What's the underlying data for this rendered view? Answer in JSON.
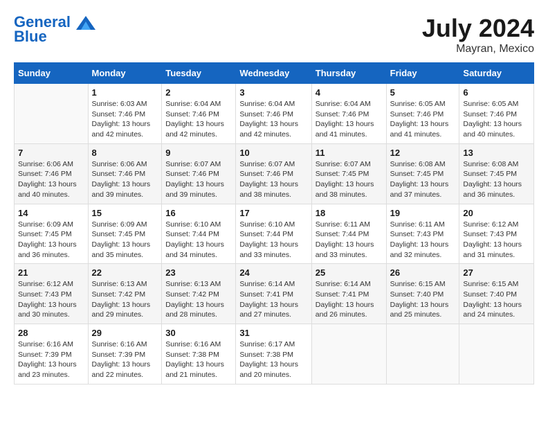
{
  "header": {
    "logo_line1": "General",
    "logo_line2": "Blue",
    "month": "July 2024",
    "location": "Mayran, Mexico"
  },
  "days_of_week": [
    "Sunday",
    "Monday",
    "Tuesday",
    "Wednesday",
    "Thursday",
    "Friday",
    "Saturday"
  ],
  "weeks": [
    [
      {
        "day": "",
        "sunrise": "",
        "sunset": "",
        "daylight": ""
      },
      {
        "day": "1",
        "sunrise": "Sunrise: 6:03 AM",
        "sunset": "Sunset: 7:46 PM",
        "daylight": "Daylight: 13 hours and 42 minutes."
      },
      {
        "day": "2",
        "sunrise": "Sunrise: 6:04 AM",
        "sunset": "Sunset: 7:46 PM",
        "daylight": "Daylight: 13 hours and 42 minutes."
      },
      {
        "day": "3",
        "sunrise": "Sunrise: 6:04 AM",
        "sunset": "Sunset: 7:46 PM",
        "daylight": "Daylight: 13 hours and 42 minutes."
      },
      {
        "day": "4",
        "sunrise": "Sunrise: 6:04 AM",
        "sunset": "Sunset: 7:46 PM",
        "daylight": "Daylight: 13 hours and 41 minutes."
      },
      {
        "day": "5",
        "sunrise": "Sunrise: 6:05 AM",
        "sunset": "Sunset: 7:46 PM",
        "daylight": "Daylight: 13 hours and 41 minutes."
      },
      {
        "day": "6",
        "sunrise": "Sunrise: 6:05 AM",
        "sunset": "Sunset: 7:46 PM",
        "daylight": "Daylight: 13 hours and 40 minutes."
      }
    ],
    [
      {
        "day": "7",
        "sunrise": "Sunrise: 6:06 AM",
        "sunset": "Sunset: 7:46 PM",
        "daylight": "Daylight: 13 hours and 40 minutes."
      },
      {
        "day": "8",
        "sunrise": "Sunrise: 6:06 AM",
        "sunset": "Sunset: 7:46 PM",
        "daylight": "Daylight: 13 hours and 39 minutes."
      },
      {
        "day": "9",
        "sunrise": "Sunrise: 6:07 AM",
        "sunset": "Sunset: 7:46 PM",
        "daylight": "Daylight: 13 hours and 39 minutes."
      },
      {
        "day": "10",
        "sunrise": "Sunrise: 6:07 AM",
        "sunset": "Sunset: 7:46 PM",
        "daylight": "Daylight: 13 hours and 38 minutes."
      },
      {
        "day": "11",
        "sunrise": "Sunrise: 6:07 AM",
        "sunset": "Sunset: 7:45 PM",
        "daylight": "Daylight: 13 hours and 38 minutes."
      },
      {
        "day": "12",
        "sunrise": "Sunrise: 6:08 AM",
        "sunset": "Sunset: 7:45 PM",
        "daylight": "Daylight: 13 hours and 37 minutes."
      },
      {
        "day": "13",
        "sunrise": "Sunrise: 6:08 AM",
        "sunset": "Sunset: 7:45 PM",
        "daylight": "Daylight: 13 hours and 36 minutes."
      }
    ],
    [
      {
        "day": "14",
        "sunrise": "Sunrise: 6:09 AM",
        "sunset": "Sunset: 7:45 PM",
        "daylight": "Daylight: 13 hours and 36 minutes."
      },
      {
        "day": "15",
        "sunrise": "Sunrise: 6:09 AM",
        "sunset": "Sunset: 7:45 PM",
        "daylight": "Daylight: 13 hours and 35 minutes."
      },
      {
        "day": "16",
        "sunrise": "Sunrise: 6:10 AM",
        "sunset": "Sunset: 7:44 PM",
        "daylight": "Daylight: 13 hours and 34 minutes."
      },
      {
        "day": "17",
        "sunrise": "Sunrise: 6:10 AM",
        "sunset": "Sunset: 7:44 PM",
        "daylight": "Daylight: 13 hours and 33 minutes."
      },
      {
        "day": "18",
        "sunrise": "Sunrise: 6:11 AM",
        "sunset": "Sunset: 7:44 PM",
        "daylight": "Daylight: 13 hours and 33 minutes."
      },
      {
        "day": "19",
        "sunrise": "Sunrise: 6:11 AM",
        "sunset": "Sunset: 7:43 PM",
        "daylight": "Daylight: 13 hours and 32 minutes."
      },
      {
        "day": "20",
        "sunrise": "Sunrise: 6:12 AM",
        "sunset": "Sunset: 7:43 PM",
        "daylight": "Daylight: 13 hours and 31 minutes."
      }
    ],
    [
      {
        "day": "21",
        "sunrise": "Sunrise: 6:12 AM",
        "sunset": "Sunset: 7:43 PM",
        "daylight": "Daylight: 13 hours and 30 minutes."
      },
      {
        "day": "22",
        "sunrise": "Sunrise: 6:13 AM",
        "sunset": "Sunset: 7:42 PM",
        "daylight": "Daylight: 13 hours and 29 minutes."
      },
      {
        "day": "23",
        "sunrise": "Sunrise: 6:13 AM",
        "sunset": "Sunset: 7:42 PM",
        "daylight": "Daylight: 13 hours and 28 minutes."
      },
      {
        "day": "24",
        "sunrise": "Sunrise: 6:14 AM",
        "sunset": "Sunset: 7:41 PM",
        "daylight": "Daylight: 13 hours and 27 minutes."
      },
      {
        "day": "25",
        "sunrise": "Sunrise: 6:14 AM",
        "sunset": "Sunset: 7:41 PM",
        "daylight": "Daylight: 13 hours and 26 minutes."
      },
      {
        "day": "26",
        "sunrise": "Sunrise: 6:15 AM",
        "sunset": "Sunset: 7:40 PM",
        "daylight": "Daylight: 13 hours and 25 minutes."
      },
      {
        "day": "27",
        "sunrise": "Sunrise: 6:15 AM",
        "sunset": "Sunset: 7:40 PM",
        "daylight": "Daylight: 13 hours and 24 minutes."
      }
    ],
    [
      {
        "day": "28",
        "sunrise": "Sunrise: 6:16 AM",
        "sunset": "Sunset: 7:39 PM",
        "daylight": "Daylight: 13 hours and 23 minutes."
      },
      {
        "day": "29",
        "sunrise": "Sunrise: 6:16 AM",
        "sunset": "Sunset: 7:39 PM",
        "daylight": "Daylight: 13 hours and 22 minutes."
      },
      {
        "day": "30",
        "sunrise": "Sunrise: 6:16 AM",
        "sunset": "Sunset: 7:38 PM",
        "daylight": "Daylight: 13 hours and 21 minutes."
      },
      {
        "day": "31",
        "sunrise": "Sunrise: 6:17 AM",
        "sunset": "Sunset: 7:38 PM",
        "daylight": "Daylight: 13 hours and 20 minutes."
      },
      {
        "day": "",
        "sunrise": "",
        "sunset": "",
        "daylight": ""
      },
      {
        "day": "",
        "sunrise": "",
        "sunset": "",
        "daylight": ""
      },
      {
        "day": "",
        "sunrise": "",
        "sunset": "",
        "daylight": ""
      }
    ]
  ]
}
